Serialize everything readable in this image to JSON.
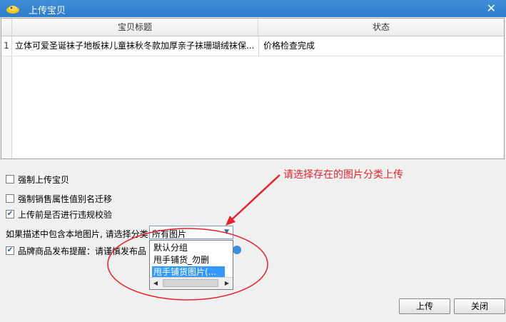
{
  "window": {
    "title": "上传宝贝",
    "close_symbol": "✕"
  },
  "grid": {
    "columns": [
      "宝贝标题",
      "状态"
    ],
    "rows": [
      {
        "index": "1",
        "title": "立体可爱圣诞袜子地板袜儿童袜秋冬款加厚亲子袜珊瑚绒袜保...",
        "status": "价格检查完成"
      }
    ]
  },
  "options": {
    "force_upload": {
      "label": "强制上传宝贝",
      "checked": false
    },
    "force_alias": {
      "label": "强制销售属性值别名迁移",
      "checked": false
    },
    "violation_check": {
      "label": "上传前是否进行违规校验",
      "checked": true
    }
  },
  "category": {
    "label": "如果描述中包含本地图片, 请选择分类",
    "selected": "所有图片",
    "options": [
      "默认分组",
      "甩手铺货_勿删",
      "甩手铺货图片(..."
    ],
    "highlighted_index": 2
  },
  "brand_notice": {
    "label": "品牌商品发布提醒：请谨慎发布品",
    "checked": true
  },
  "annotation": {
    "text": "请选择存在的图片分类上传",
    "color": "#e8222a"
  },
  "buttons": {
    "upload": "上传",
    "close": "关闭"
  },
  "colors": {
    "titlebar": "#2d7ccb",
    "selection": "#3399ff",
    "annotation": "#e8222a"
  }
}
